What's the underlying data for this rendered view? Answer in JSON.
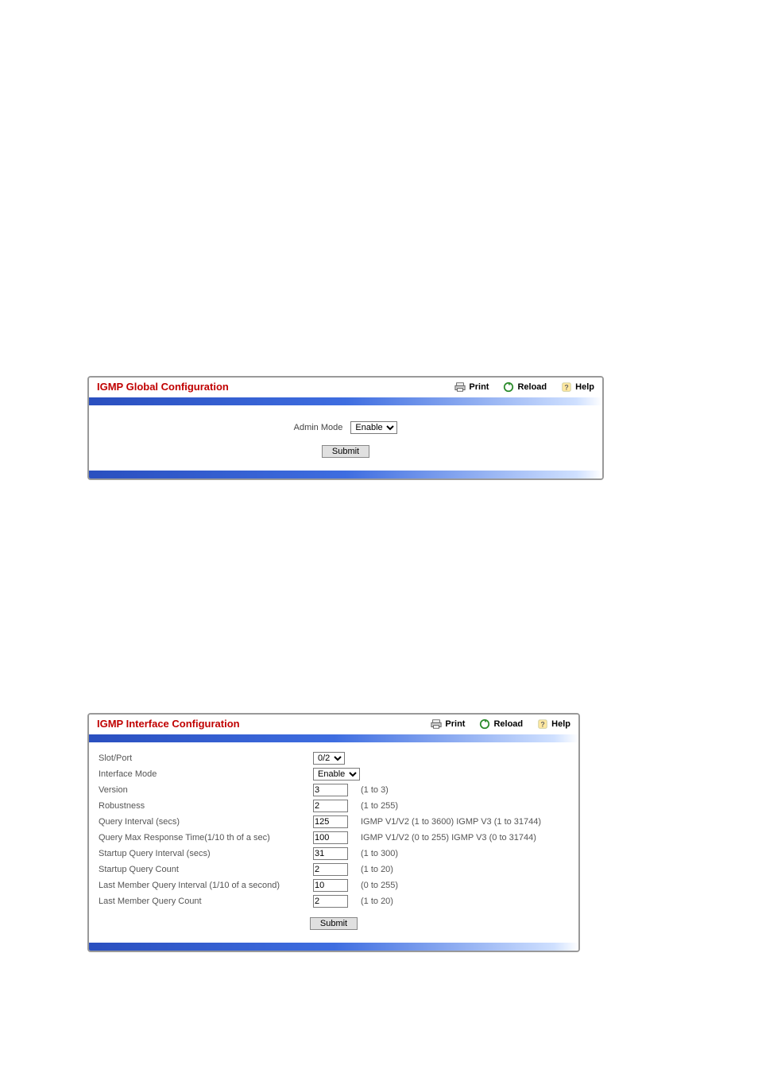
{
  "common": {
    "print": "Print",
    "reload": "Reload",
    "help": "Help",
    "submit": "Submit"
  },
  "panel1": {
    "title": "IGMP Global Configuration",
    "admin_mode_label": "Admin Mode",
    "admin_mode_value": "Enable"
  },
  "panel2": {
    "title": "IGMP Interface Configuration",
    "rows": [
      {
        "label": "Slot/Port",
        "type": "select",
        "value": "0/2",
        "hint": ""
      },
      {
        "label": "Interface Mode",
        "type": "select",
        "value": "Enable",
        "hint": ""
      },
      {
        "label": "Version",
        "type": "text",
        "value": "3",
        "hint": "(1 to 3)"
      },
      {
        "label": "Robustness",
        "type": "text",
        "value": "2",
        "hint": "(1 to 255)"
      },
      {
        "label": "Query Interval (secs)",
        "type": "text",
        "value": "125",
        "hint": "IGMP V1/V2 (1 to 3600) IGMP V3 (1 to 31744)"
      },
      {
        "label": "Query Max Response Time(1/10 th of a sec)",
        "type": "text",
        "value": "100",
        "hint": "IGMP V1/V2 (0 to 255) IGMP V3 (0 to 31744)"
      },
      {
        "label": "Startup Query Interval (secs)",
        "type": "text",
        "value": "31",
        "hint": "(1 to 300)"
      },
      {
        "label": "Startup Query Count",
        "type": "text",
        "value": "2",
        "hint": "(1 to 20)"
      },
      {
        "label": "Last Member Query Interval (1/10 of a second)",
        "type": "text",
        "value": "10",
        "hint": "(0 to 255)"
      },
      {
        "label": "Last Member Query Count",
        "type": "text",
        "value": "2",
        "hint": "(1 to 20)"
      }
    ]
  }
}
